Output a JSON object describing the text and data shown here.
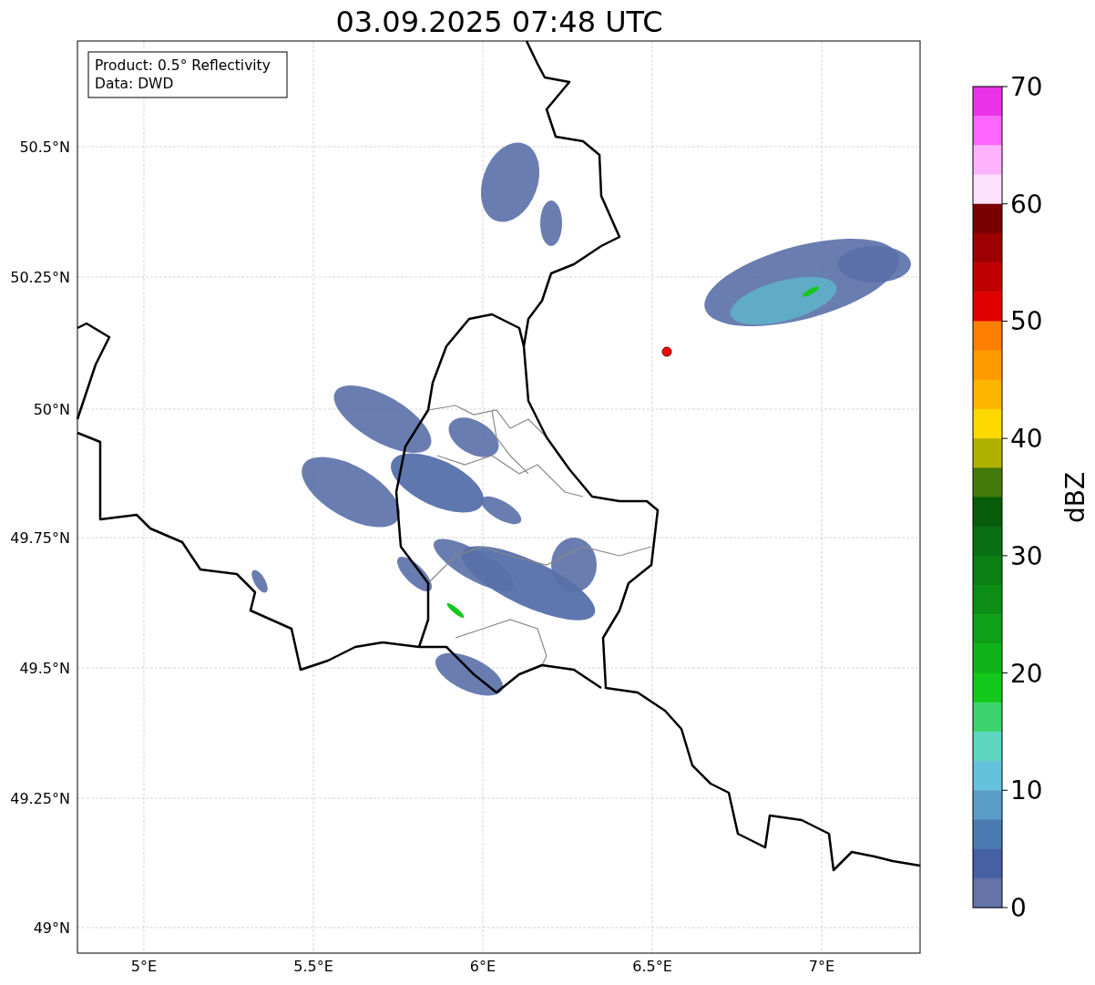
{
  "title": "03.09.2025 07:48 UTC",
  "annotation": [
    "Product: 0.5° Reflectivity",
    "Data: DWD"
  ],
  "map": {
    "lat_ticks": [
      {
        "label": "50.5°N"
      },
      {
        "label": "50.25°N"
      },
      {
        "label": "50°N"
      },
      {
        "label": "49.75°N"
      },
      {
        "label": "49.5°N"
      },
      {
        "label": "49.25°N"
      },
      {
        "label": "49°N"
      }
    ],
    "lon_ticks": [
      {
        "label": "5°E"
      },
      {
        "label": "5.5°E"
      },
      {
        "label": "6°E"
      },
      {
        "label": "6.5°E"
      },
      {
        "label": "7°E"
      }
    ]
  },
  "colorbar": {
    "label": "dBZ",
    "ticks": [
      "70",
      "60",
      "50",
      "40",
      "30",
      "20",
      "10",
      "0"
    ],
    "bins": [
      {
        "color": "#e933e9"
      },
      {
        "color": "#fc66fc"
      },
      {
        "color": "#fdb2fd"
      },
      {
        "color": "#fde0fd"
      },
      {
        "color": "#780000"
      },
      {
        "color": "#9c0000"
      },
      {
        "color": "#c00000"
      },
      {
        "color": "#e00000"
      },
      {
        "color": "#fd7e00"
      },
      {
        "color": "#fd9a00"
      },
      {
        "color": "#fdb500"
      },
      {
        "color": "#fdd900"
      },
      {
        "color": "#b0b000"
      },
      {
        "color": "#447a0a"
      },
      {
        "color": "#085c0a"
      },
      {
        "color": "#0a6e12"
      },
      {
        "color": "#0b7e14"
      },
      {
        "color": "#0c8e16"
      },
      {
        "color": "#0da018"
      },
      {
        "color": "#10b41a"
      },
      {
        "color": "#14c81c"
      },
      {
        "color": "#3cd46c"
      },
      {
        "color": "#5fd6c0"
      },
      {
        "color": "#66c2dc"
      },
      {
        "color": "#5a9ec8"
      },
      {
        "color": "#4a7ab0"
      },
      {
        "color": "#4660a4"
      },
      {
        "color": "#6473a8"
      }
    ]
  }
}
